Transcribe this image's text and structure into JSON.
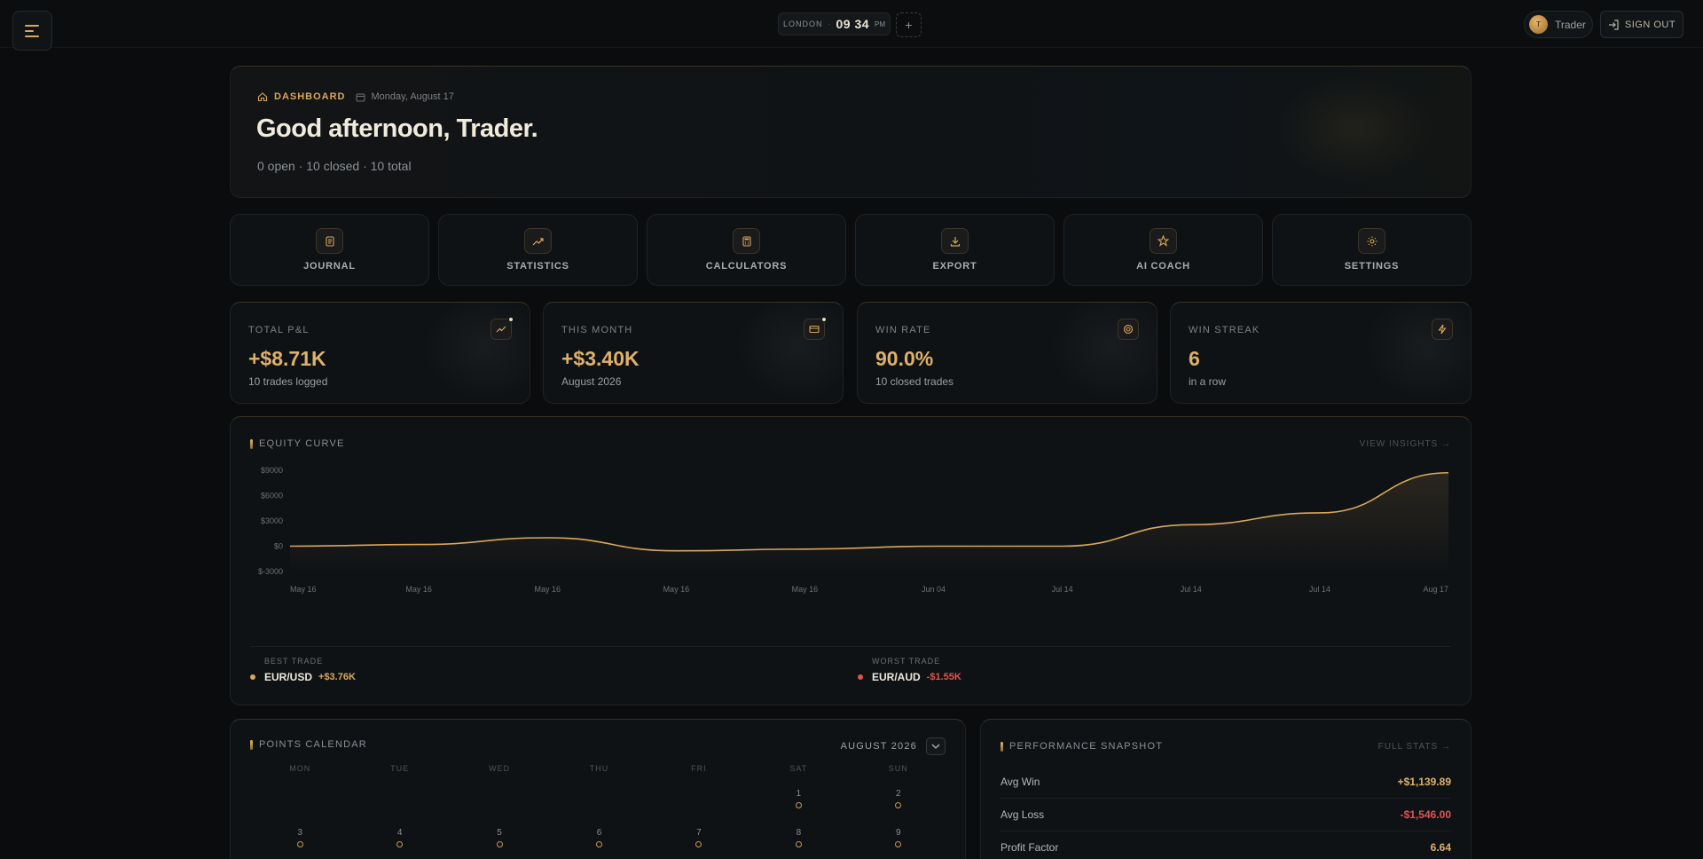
{
  "topbar": {
    "clock": {
      "city": "LONDON",
      "separator": "·",
      "time": "09 34",
      "ampm": "PM"
    },
    "add_clock_symbol": "+",
    "user": {
      "initial": "T",
      "name": "Trader"
    },
    "signout_label": "SIGN OUT"
  },
  "hero": {
    "crumb_label": "DASHBOARD",
    "date": "Monday, August 17",
    "greeting": "Good afternoon, Trader.",
    "summary": "0 open · 10 closed · 10 total"
  },
  "nav_tiles": [
    {
      "label": "JOURNAL",
      "icon": "journal-icon"
    },
    {
      "label": "STATISTICS",
      "icon": "trend-icon"
    },
    {
      "label": "CALCULATORS",
      "icon": "calculator-icon"
    },
    {
      "label": "EXPORT",
      "icon": "download-icon"
    },
    {
      "label": "AI COACH",
      "icon": "star-icon"
    },
    {
      "label": "SETTINGS",
      "icon": "sun-icon"
    }
  ],
  "stats": [
    {
      "label": "TOTAL P&L",
      "value": "+$8.71K",
      "sub": "10 trades logged",
      "icon": "trend-icon"
    },
    {
      "label": "THIS MONTH",
      "value": "+$3.40K",
      "sub": "August 2026",
      "icon": "card-icon"
    },
    {
      "label": "WIN RATE",
      "value": "90.0%",
      "sub": "10 closed trades",
      "icon": "target-icon"
    },
    {
      "label": "WIN STREAK",
      "value": "6",
      "sub": "in a row",
      "icon": "bolt-icon"
    }
  ],
  "equity": {
    "title": "EQUITY CURVE",
    "link": "VIEW INSIGHTS →",
    "best": {
      "label": "BEST TRADE",
      "symbol": "EUR/USD",
      "pnl": "+$3.76K"
    },
    "worst": {
      "label": "WORST TRADE",
      "symbol": "EUR/AUD",
      "pnl": "-$1.55K"
    }
  },
  "chart_data": {
    "type": "area",
    "title": "EQUITY CURVE",
    "x": [
      "May 16",
      "May 16",
      "May 16",
      "May 16",
      "May 16",
      "Jun 04",
      "Jul 14",
      "Jul 14",
      "Jul 14",
      "Aug 17"
    ],
    "values": [
      0,
      200,
      1000,
      -550,
      -350,
      0,
      0,
      2550,
      3950,
      8710
    ],
    "y_ticks": [
      "$9000",
      "$6000",
      "$3000",
      "$0",
      "$-3000"
    ],
    "ylim": [
      -3000,
      9000
    ],
    "grid": false,
    "line_color": "#d9a75c"
  },
  "calendar": {
    "title": "POINTS CALENDAR",
    "month": "AUGUST 2026",
    "weekdays": [
      "MON",
      "TUE",
      "WED",
      "THU",
      "FRI",
      "SAT",
      "SUN"
    ],
    "days": [
      "",
      "",
      "",
      "",
      "",
      "1",
      "2",
      "3",
      "4",
      "5",
      "6",
      "7",
      "8",
      "9"
    ]
  },
  "performance": {
    "title": "PERFORMANCE SNAPSHOT",
    "link": "FULL STATS →",
    "rows": [
      {
        "label": "Avg Win",
        "value": "+$1,139.89",
        "color": "#deb06a"
      },
      {
        "label": "Avg Loss",
        "value": "-$1,546.00",
        "color": "#e0544f"
      },
      {
        "label": "Profit Factor",
        "value": "6.64",
        "color": "#deb06a"
      }
    ]
  },
  "colors": {
    "accent": "#d9a75c",
    "negative": "#e0544f",
    "background": "#0a0c0e"
  }
}
